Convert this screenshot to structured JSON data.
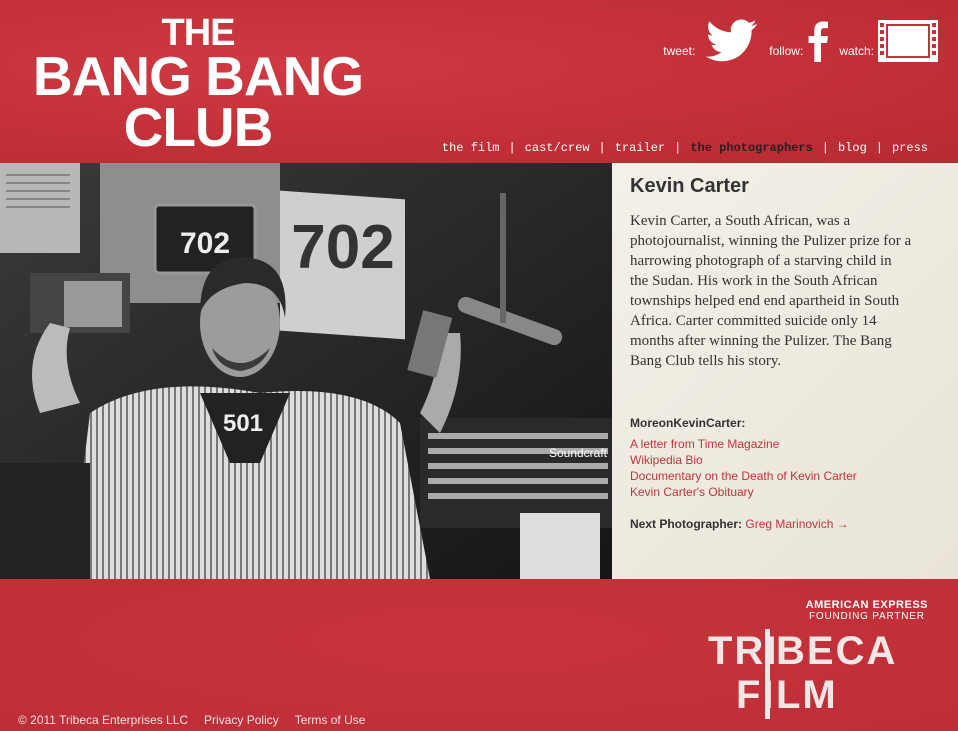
{
  "header": {
    "logo": {
      "line1": "THE",
      "line2": "BANG BANG",
      "line3": "CLUB"
    },
    "social": {
      "tweet_label": "tweet:",
      "follow_label": "follow:",
      "watch_label": "watch:"
    },
    "nav": [
      {
        "label": "the film",
        "active": false
      },
      {
        "label": "cast/crew",
        "active": false
      },
      {
        "label": "trailer",
        "active": false
      },
      {
        "label": "the photographers",
        "active": true
      },
      {
        "label": "blog",
        "active": false
      },
      {
        "label": "press",
        "active": false
      }
    ],
    "nav_separator": "|"
  },
  "photo": {
    "sign_text": "702",
    "monitor_text": "702",
    "shirt_text": "501",
    "console_text": "Soundcraft"
  },
  "content": {
    "name": "Kevin Carter",
    "bio": "Kevin Carter, a South African, was a photojournalist, winning the Pulizer prize for a harrowing photograph of a starving child in the Sudan. His work in the South African townships helped end end apartheid in South Africa. Carter committed suicide only 14 months after winning the Pulizer. The Bang Bang Club tells his story.",
    "more_heading": "MoreonKevinCarter:",
    "links": [
      "A letter from Time Magazine",
      "Wikipedia Bio",
      "Documentary on the Death of Kevin Carter",
      "Kevin Carter's Obituary"
    ],
    "next_label": "Next Photographer:",
    "next_link": "Greg Marinovich →"
  },
  "footer": {
    "sponsor_line1": "AMERICAN EXPRESS",
    "sponsor_line2": "FOUNDING PARTNER",
    "brand_tri": "TRI",
    "brand_beca": "BECA",
    "brand_fi": "FI",
    "brand_lm": "LM",
    "copyright": "© 2011 Tribeca Enterprises LLC",
    "privacy": "Privacy Policy",
    "terms": "Terms of Use"
  },
  "colors": {
    "brand_red": "#c5323a",
    "link_red": "#c5323a",
    "panel_bg": "#f1ede4"
  }
}
